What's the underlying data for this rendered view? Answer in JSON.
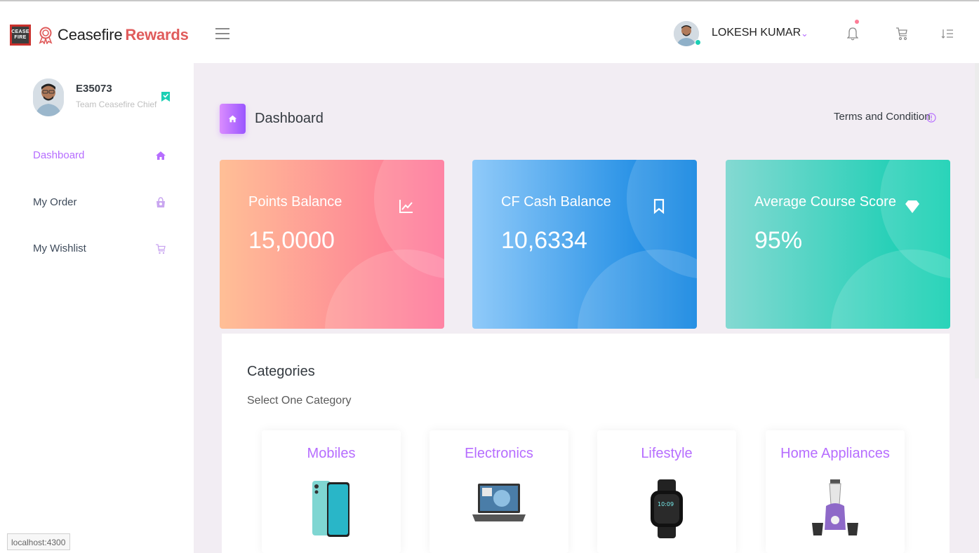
{
  "brand": {
    "name_part1": "Ceasefire",
    "name_part2": "Rewards",
    "logo_line1": "CEASE",
    "logo_line2": "FIRE"
  },
  "navbar": {
    "username": "LOKESH KUMAR",
    "caret": "⌄"
  },
  "profile": {
    "id": "E35073",
    "role": "Team Ceasefire Chief"
  },
  "sidebar": {
    "items": [
      {
        "label": "Dashboard",
        "icon": "home-icon",
        "active": true
      },
      {
        "label": "My Order",
        "icon": "shopping-bag-icon",
        "active": false
      },
      {
        "label": "My Wishlist",
        "icon": "cart-icon",
        "active": false
      }
    ]
  },
  "page": {
    "title": "Dashboard",
    "terms": "Terms and Condition"
  },
  "cards": [
    {
      "title": "Points Balance",
      "value": "15,0000",
      "icon": "chart-line-icon",
      "color_from": "#ffbf96",
      "color_to": "#fe7096"
    },
    {
      "title": "CF Cash Balance",
      "value": "10,6334",
      "icon": "bookmark-icon",
      "color_from": "#90caf9",
      "color_to": "#047edf"
    },
    {
      "title": "Average Course Score",
      "value": "95%",
      "icon": "diamond-icon",
      "color_from": "#84d9d2",
      "color_to": "#07cdae"
    }
  ],
  "categories": {
    "title": "Categories",
    "subtitle": "Select One Category",
    "items": [
      {
        "name": "Mobiles",
        "image": "phone-image"
      },
      {
        "name": "Electronics",
        "image": "laptop-image"
      },
      {
        "name": "Lifestyle",
        "image": "smartwatch-image"
      },
      {
        "name": "Home Appliances",
        "image": "mixer-grinder-image"
      }
    ]
  },
  "statusbar": {
    "url": "localhost:4300"
  },
  "colors": {
    "accent": "#b66dff",
    "online": "#1bcfb4",
    "notification": "#fe7c96"
  }
}
